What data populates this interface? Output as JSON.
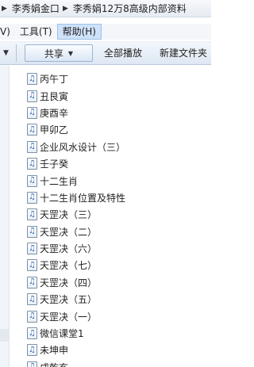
{
  "breadcrumb": {
    "items": [
      "李秀娟金口",
      "李秀娟12万8高级内部资料"
    ]
  },
  "menubar": {
    "items": [
      {
        "label": "V)"
      },
      {
        "label": "工具(T)"
      },
      {
        "label": "帮助(H)"
      }
    ]
  },
  "toolbar": {
    "share_label": "共享",
    "play_all_label": "全部播放",
    "new_folder_label": "新建文件夹"
  },
  "files": [
    {
      "name": "丙午丁"
    },
    {
      "name": "丑艮寅"
    },
    {
      "name": "庚酉辛"
    },
    {
      "name": "甲卯乙"
    },
    {
      "name": "企业风水设计（三）"
    },
    {
      "name": "壬子癸"
    },
    {
      "name": "十二生肖"
    },
    {
      "name": "十二生肖位置及特性"
    },
    {
      "name": "天罡决（三）"
    },
    {
      "name": "天罡决（二）"
    },
    {
      "name": "天罡决（六）"
    },
    {
      "name": "天罡决（七）"
    },
    {
      "name": "天罡决（四）"
    },
    {
      "name": "天罡决（五）"
    },
    {
      "name": "天罡决（一）"
    },
    {
      "name": "微信课堂1"
    },
    {
      "name": "未坤申"
    },
    {
      "name": "戌乾亥"
    }
  ],
  "icons": {
    "file": "music-file-icon",
    "note_glyph": "♫"
  },
  "colors": {
    "menu_active": "#cfe2f9",
    "icon_note": "#2a62b5"
  }
}
